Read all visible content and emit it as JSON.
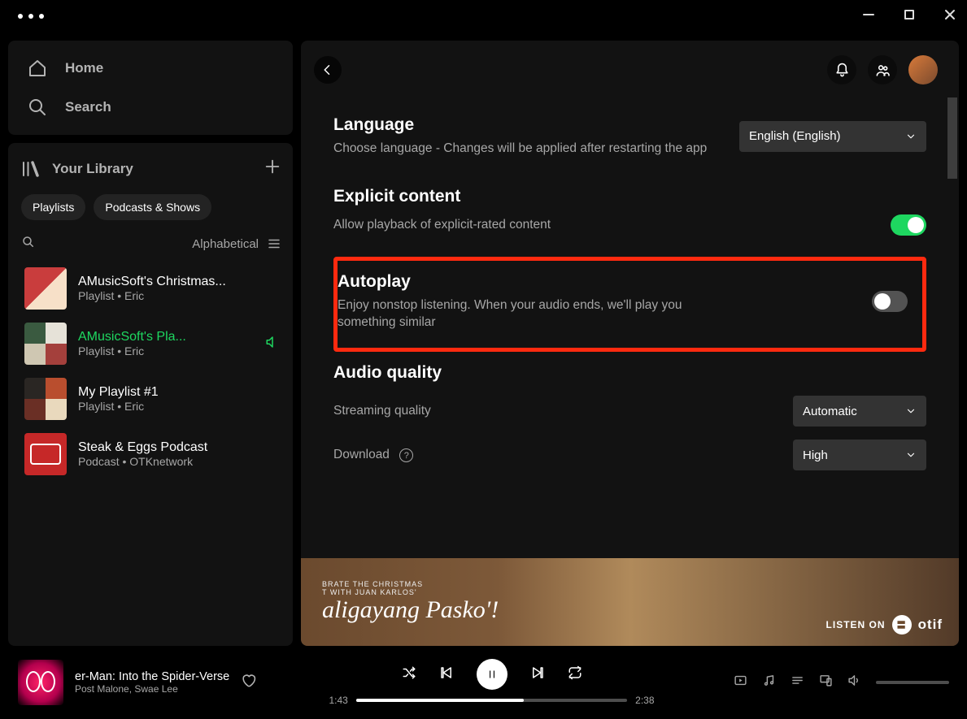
{
  "nav": {
    "home": "Home",
    "search": "Search"
  },
  "library": {
    "title": "Your Library",
    "chips": [
      "Playlists",
      "Podcasts & Shows"
    ],
    "sort": "Alphabetical",
    "items": [
      {
        "name": "AMusicSoft's Christmas...",
        "sub": "Playlist • Eric",
        "active": false
      },
      {
        "name": "AMusicSoft's Pla...",
        "sub": "Playlist • Eric",
        "active": true
      },
      {
        "name": "My Playlist #1",
        "sub": "Playlist • Eric",
        "active": false
      },
      {
        "name": "Steak & Eggs Podcast",
        "sub": "Podcast • OTKnetwork",
        "active": false
      }
    ]
  },
  "settings": {
    "language": {
      "title": "Language",
      "desc": "Choose language - Changes will be applied after restarting the app",
      "value": "English (English)"
    },
    "explicit": {
      "title": "Explicit content",
      "desc": "Allow playback of explicit-rated content",
      "on": true
    },
    "autoplay": {
      "title": "Autoplay",
      "desc": "Enjoy nonstop listening. When your audio ends, we'll play you something similar",
      "on": false
    },
    "audio": {
      "title": "Audio quality",
      "streaming_label": "Streaming quality",
      "streaming_value": "Automatic",
      "download_label": "Download",
      "download_value": "High"
    }
  },
  "banner": {
    "line1": "BRATE THE CHRISTMAS",
    "line2": "T WITH JUAN KARLOS'",
    "headline": "aligayang Pasko'!",
    "listen": "LISTEN ON",
    "brand": "otif"
  },
  "player": {
    "title": "er-Man: Into the Spider-Verse",
    "artist": "Post Malone, Swae Lee",
    "elapsed": "1:43",
    "total": "2:38",
    "progress_pct": 62
  }
}
